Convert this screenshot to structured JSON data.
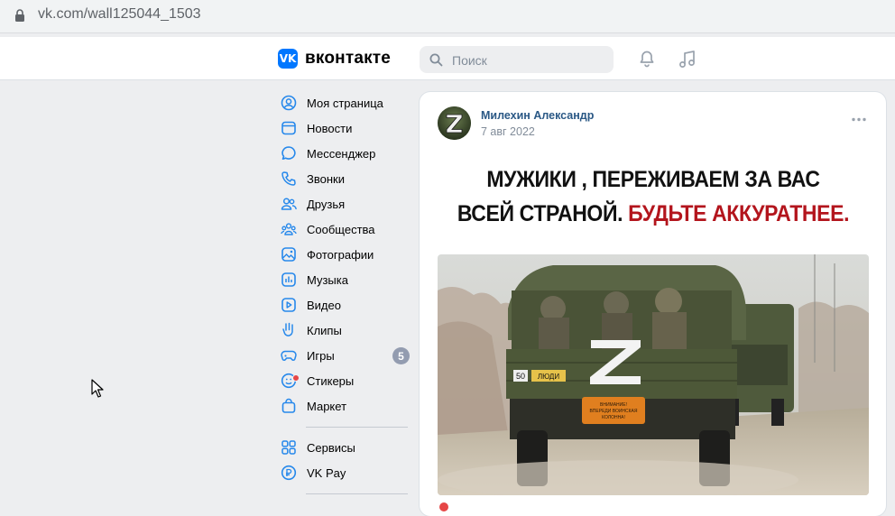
{
  "browser": {
    "url_domain": "vk.com/",
    "url_path": "wall125044_1503"
  },
  "header": {
    "logo_badge": "VK",
    "logo_text": "вконтакте",
    "search_placeholder": "Поиск"
  },
  "nav": {
    "items": [
      {
        "label": "Моя страница",
        "icon": "user-circle-icon"
      },
      {
        "label": "Новости",
        "icon": "newspaper-icon"
      },
      {
        "label": "Мессенджер",
        "icon": "message-icon"
      },
      {
        "label": "Звонки",
        "icon": "phone-icon"
      },
      {
        "label": "Друзья",
        "icon": "friends-icon"
      },
      {
        "label": "Сообщества",
        "icon": "communities-icon"
      },
      {
        "label": "Фотографии",
        "icon": "photo-icon"
      },
      {
        "label": "Музыка",
        "icon": "music-icon"
      },
      {
        "label": "Видео",
        "icon": "video-icon"
      },
      {
        "label": "Клипы",
        "icon": "clips-icon"
      },
      {
        "label": "Игры",
        "icon": "gamepad-icon",
        "badge": "5"
      },
      {
        "label": "Стикеры",
        "icon": "sticker-icon"
      },
      {
        "label": "Маркет",
        "icon": "bag-icon"
      }
    ],
    "secondary": [
      {
        "label": "Сервисы",
        "icon": "services-icon"
      },
      {
        "label": "VK Pay",
        "icon": "vkpay-icon"
      }
    ]
  },
  "post": {
    "author": "Милехин Александр",
    "date": "7 авг 2022",
    "headline_line1": "МУЖИКИ , ПЕРЕЖИВАЕМ ЗА ВАС",
    "headline_line2_black": "ВСЕЙ СТРАНОЙ.",
    "headline_line2_red": "БУДЬТЕ АККУРАТНЕЕ.",
    "image_text": {
      "plate": "50",
      "sign": "ЛЮДИ",
      "z_mark": "Z",
      "warning": "ВНИМАНИЕ! ВПЕРЕДИ ВОИНСКАЯ КОЛОННА!"
    }
  },
  "colors": {
    "vk_blue": "#0077ff",
    "link": "#2a5885",
    "icon": "#2688eb",
    "headline_red": "#b3151d"
  }
}
